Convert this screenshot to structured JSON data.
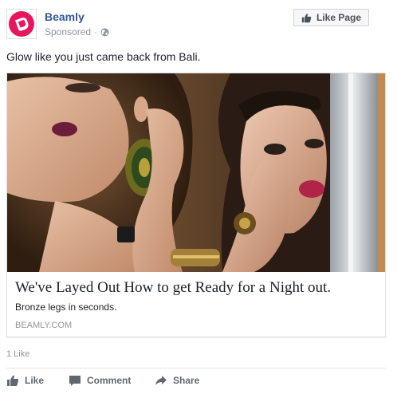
{
  "post": {
    "page_name": "Beamly",
    "sponsored_label": "Sponsored",
    "separator": "·",
    "privacy_icon": "globe-icon",
    "like_page_label": "Like Page",
    "text": "Glow like you just came back from Bali."
  },
  "link": {
    "headline": "We've Layed Out How to get Ready for a Night out.",
    "description": "Bronze legs in seconds.",
    "domain": "BEAMLY.COM"
  },
  "engagement": {
    "like_count": "1 Like"
  },
  "actions": {
    "like_label": "Like",
    "comment_label": "Comment",
    "share_label": "Share"
  },
  "colors": {
    "brand_logo": "#e8175d",
    "link_blue": "#365899",
    "meta_gray": "#90949c"
  }
}
